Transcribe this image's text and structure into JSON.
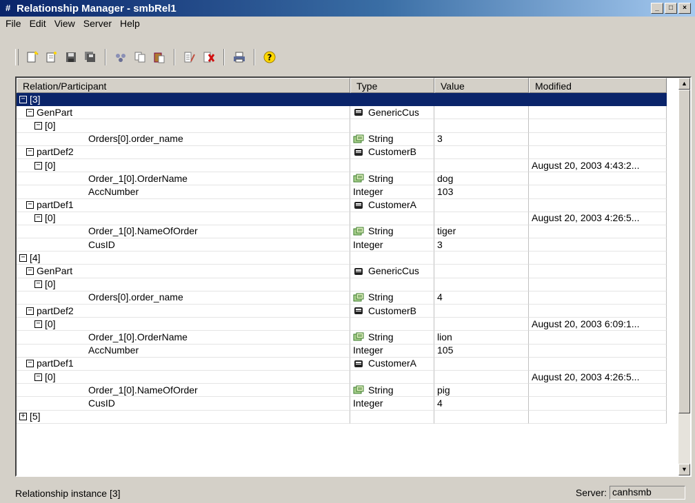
{
  "window": {
    "title": "Relationship Manager - smbRel1",
    "controls": [
      "minimize",
      "maximize",
      "close"
    ]
  },
  "menu": [
    {
      "label": "File"
    },
    {
      "label": "Edit"
    },
    {
      "label": "View"
    },
    {
      "label": "Server"
    },
    {
      "label": "Help"
    }
  ],
  "toolbar": {
    "icons": [
      "new-relationship-icon",
      "new-participant-icon",
      "save-icon",
      "save-all-icon",
      "find-icon",
      "copy-icon",
      "paste-icon",
      "properties-icon",
      "delete-icon",
      "print-icon",
      "help-icon"
    ]
  },
  "grid": {
    "headers": [
      "Relation/Participant",
      "Type",
      "Value",
      "Modified"
    ],
    "rows": [
      {
        "indent": 0,
        "toggle": "−",
        "name": "[3]",
        "type": "",
        "type_icon": "",
        "value": "",
        "modified": "",
        "selected": true
      },
      {
        "indent": 1,
        "toggle": "−",
        "name": "GenPart",
        "type": "GenericCus",
        "type_icon": "object",
        "value": "",
        "modified": ""
      },
      {
        "indent": 2,
        "toggle": "−",
        "name": "[0]",
        "type": "",
        "type_icon": "",
        "value": "",
        "modified": ""
      },
      {
        "indent": 3,
        "toggle": "",
        "name": "Orders[0].order_name",
        "type": "String",
        "type_icon": "attribute",
        "value": "3",
        "modified": ""
      },
      {
        "indent": 1,
        "toggle": "−",
        "name": "partDef2",
        "type": "CustomerB",
        "type_icon": "object",
        "value": "",
        "modified": ""
      },
      {
        "indent": 2,
        "toggle": "−",
        "name": "[0]",
        "type": "",
        "type_icon": "",
        "value": "",
        "modified": "August 20, 2003 4:43:2..."
      },
      {
        "indent": 3,
        "toggle": "",
        "name": "Order_1[0].OrderName",
        "type": "String",
        "type_icon": "attribute",
        "value": "dog",
        "modified": ""
      },
      {
        "indent": 3,
        "toggle": "",
        "name": "AccNumber",
        "type": "Integer",
        "type_icon": "",
        "value": "103",
        "modified": ""
      },
      {
        "indent": 1,
        "toggle": "−",
        "name": "partDef1",
        "type": "CustomerA",
        "type_icon": "object",
        "value": "",
        "modified": ""
      },
      {
        "indent": 2,
        "toggle": "−",
        "name": "[0]",
        "type": "",
        "type_icon": "",
        "value": "",
        "modified": "August 20, 2003 4:26:5..."
      },
      {
        "indent": 3,
        "toggle": "",
        "name": "Order_1[0].NameOfOrder",
        "type": "String",
        "type_icon": "attribute",
        "value": "tiger",
        "modified": ""
      },
      {
        "indent": 3,
        "toggle": "",
        "name": "CusID",
        "type": "Integer",
        "type_icon": "",
        "value": "3",
        "modified": ""
      },
      {
        "indent": 0,
        "toggle": "−",
        "name": "[4]",
        "type": "",
        "type_icon": "",
        "value": "",
        "modified": ""
      },
      {
        "indent": 1,
        "toggle": "−",
        "name": "GenPart",
        "type": "GenericCus",
        "type_icon": "object",
        "value": "",
        "modified": ""
      },
      {
        "indent": 2,
        "toggle": "−",
        "name": "[0]",
        "type": "",
        "type_icon": "",
        "value": "",
        "modified": ""
      },
      {
        "indent": 3,
        "toggle": "",
        "name": "Orders[0].order_name",
        "type": "String",
        "type_icon": "attribute",
        "value": "4",
        "modified": ""
      },
      {
        "indent": 1,
        "toggle": "−",
        "name": "partDef2",
        "type": "CustomerB",
        "type_icon": "object",
        "value": "",
        "modified": ""
      },
      {
        "indent": 2,
        "toggle": "−",
        "name": "[0]",
        "type": "",
        "type_icon": "",
        "value": "",
        "modified": "August 20, 2003 6:09:1..."
      },
      {
        "indent": 3,
        "toggle": "",
        "name": "Order_1[0].OrderName",
        "type": "String",
        "type_icon": "attribute",
        "value": "lion",
        "modified": ""
      },
      {
        "indent": 3,
        "toggle": "",
        "name": "AccNumber",
        "type": "Integer",
        "type_icon": "",
        "value": "105",
        "modified": ""
      },
      {
        "indent": 1,
        "toggle": "−",
        "name": "partDef1",
        "type": "CustomerA",
        "type_icon": "object",
        "value": "",
        "modified": ""
      },
      {
        "indent": 2,
        "toggle": "−",
        "name": "[0]",
        "type": "",
        "type_icon": "",
        "value": "",
        "modified": "August 20, 2003 4:26:5..."
      },
      {
        "indent": 3,
        "toggle": "",
        "name": "Order_1[0].NameOfOrder",
        "type": "String",
        "type_icon": "attribute",
        "value": "pig",
        "modified": ""
      },
      {
        "indent": 3,
        "toggle": "",
        "name": "CusID",
        "type": "Integer",
        "type_icon": "",
        "value": "4",
        "modified": ""
      },
      {
        "indent": 0,
        "toggle": "+",
        "name": "[5]",
        "type": "",
        "type_icon": "",
        "value": "",
        "modified": ""
      }
    ]
  },
  "status": {
    "message": "Relationship instance [3]",
    "server_label": "Server:",
    "server_value": "canhsmb"
  },
  "colors": {
    "selection": "#0a246a",
    "face": "#d4d0c8"
  }
}
